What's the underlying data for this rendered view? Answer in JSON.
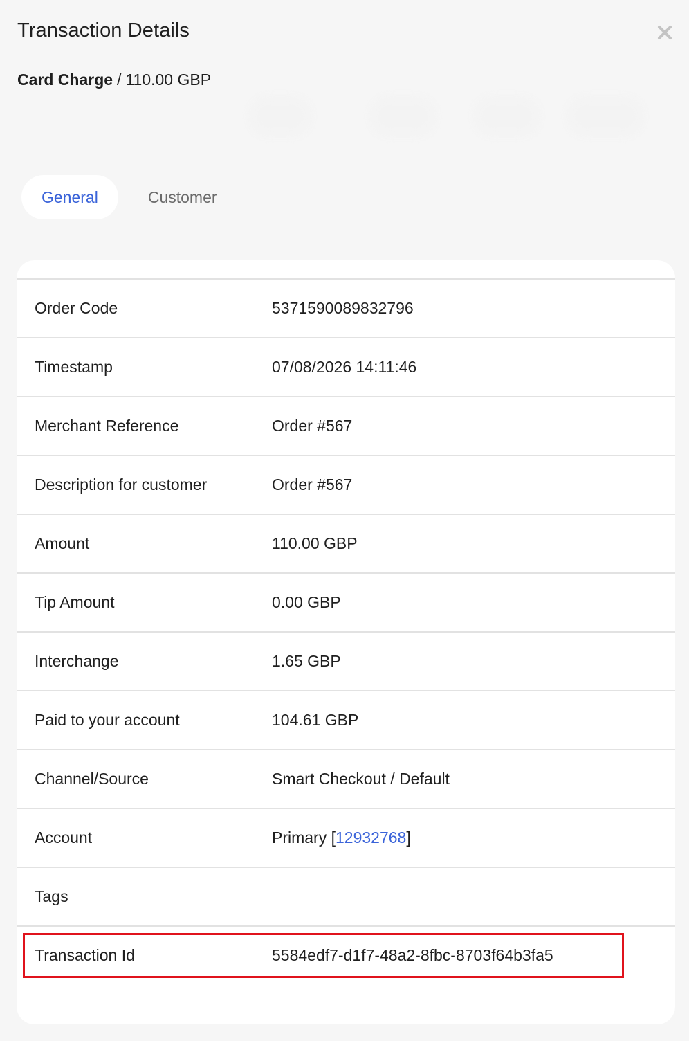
{
  "header": {
    "title": "Transaction Details",
    "close_icon": "close-icon",
    "transaction_type": "Card Charge",
    "separator": "/",
    "amount": "110.00 GBP"
  },
  "tabs": [
    {
      "label": "General",
      "active": true
    },
    {
      "label": "Customer",
      "active": false
    }
  ],
  "details": {
    "order_code": {
      "label": "Order Code",
      "value": "5371590089832796"
    },
    "timestamp": {
      "label": "Timestamp",
      "value": "07/08/2026 14:11:46"
    },
    "merchant_reference": {
      "label": "Merchant Reference",
      "value": "Order #567"
    },
    "description": {
      "label": "Description for customer",
      "value": "Order #567"
    },
    "amount": {
      "label": "Amount",
      "value": "110.00 GBP"
    },
    "tip_amount": {
      "label": "Tip Amount",
      "value": "0.00 GBP"
    },
    "interchange": {
      "label": "Interchange",
      "value": "1.65 GBP"
    },
    "paid": {
      "label": "Paid to your account",
      "value": "104.61 GBP"
    },
    "channel": {
      "label": "Channel/Source",
      "value": "Smart Checkout / Default"
    },
    "account": {
      "label": "Account",
      "name": "Primary",
      "open_bracket": "[",
      "id": "12932768",
      "close_bracket": "]"
    },
    "tags": {
      "label": "Tags",
      "value": ""
    },
    "transaction_id": {
      "label": "Transaction Id",
      "value": "5584edf7-d1f7-48a2-8fbc-8703f64b3fa5"
    }
  },
  "colors": {
    "accent": "#3a63d9",
    "highlight_border": "#e0131c",
    "background": "#f6f6f6",
    "card": "#ffffff"
  }
}
